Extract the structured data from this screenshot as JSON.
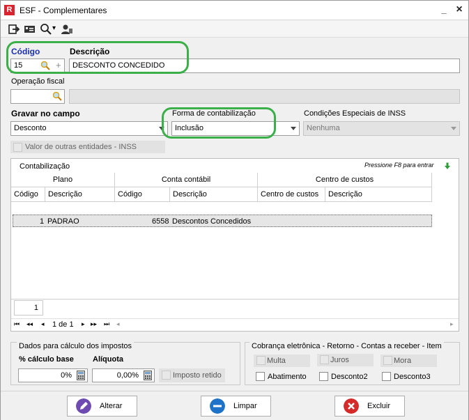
{
  "window": {
    "app_icon_letter": "R",
    "title": "ESF - Complementares",
    "minimize": "_",
    "close": "×"
  },
  "toolbar": {
    "icons": [
      "exit-icon",
      "card-icon",
      "search-icon",
      "user-icon"
    ],
    "search_dropdown": "▾"
  },
  "header": {
    "codigo_label": "Código",
    "codigo_value": "15",
    "plus": "+",
    "descricao_label": "Descrição",
    "descricao_value": "DESCONTO CONCEDIDO"
  },
  "operacao": {
    "label": "Operação fiscal",
    "value": ""
  },
  "gravar": {
    "label": "Gravar no campo",
    "value": "Desconto"
  },
  "forma": {
    "label": "Forma de contabilização",
    "value": "Inclusão"
  },
  "condicoes": {
    "label": "Condições Especiais de INSS",
    "value": "Nenhuma"
  },
  "valor_outras": {
    "label": "Valor de outras entidades - INSS"
  },
  "contab": {
    "title": "Contabilização",
    "hint": "Pressione F8 para entrar",
    "groups": [
      "Plano",
      "Conta contábil",
      "Centro de custos"
    ],
    "columns": [
      "Código",
      "Descrição",
      "Código",
      "Descrição",
      "Centro de custos",
      "Descrição"
    ],
    "rows": [
      {
        "plano_codigo": "1",
        "plano_desc": "PADRAO",
        "conta_codigo": "6558",
        "conta_desc": "Descontos Concedidos",
        "cc_codigo": "",
        "cc_desc": ""
      }
    ],
    "count": "1",
    "pager": {
      "first": "⏮",
      "prev_page": "◂◂",
      "prev": "◂",
      "text": "1 de 1",
      "next": "▸",
      "next_page": "▸▸",
      "last": "⏭",
      "extra": "◂"
    },
    "scroll_right": "▸"
  },
  "impostos": {
    "title": "Dados para cálculo dos impostos",
    "calc_label": "% cálculo base",
    "calc_value": "0%",
    "aliq_label": "Alíquota",
    "aliq_value": "0,00%",
    "retido_label": "Imposto retido"
  },
  "cobranca": {
    "title": "Cobrança eletrônica - Retorno - Contas a receber - Item",
    "items": [
      "Multa",
      "Juros",
      "Mora",
      "Abatimento",
      "Desconto2",
      "Desconto3"
    ]
  },
  "buttons": {
    "alterar": "Alterar",
    "limpar": "Limpar",
    "excluir": "Excluir"
  },
  "colors": {
    "highlight": "#3bb04a",
    "label_blue": "#1a2fb4",
    "alterar_icon": "#6d4bb0",
    "limpar_icon": "#1e73c8",
    "excluir_icon": "#d42a2a",
    "hint_arrow": "#2f9e3a"
  }
}
